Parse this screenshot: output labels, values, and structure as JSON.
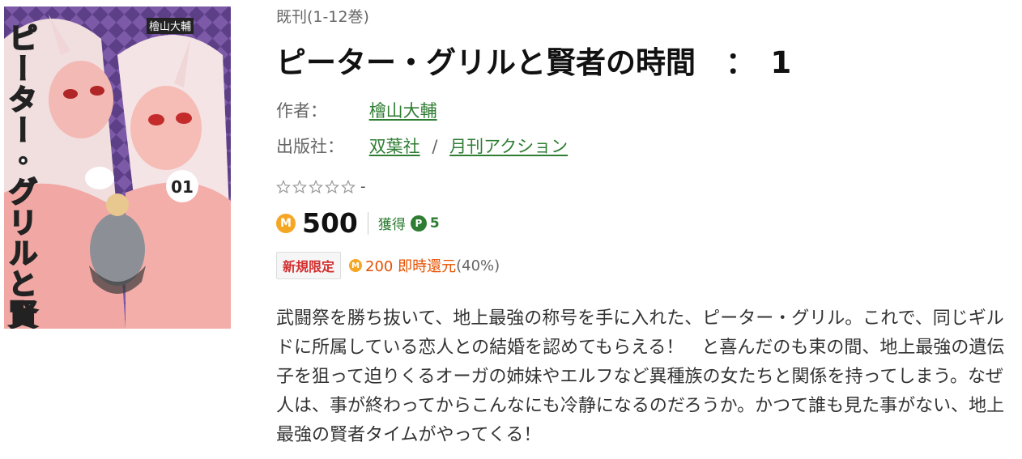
{
  "cover": {
    "title_art": "ピーター・グリルと賢者の時間",
    "author_art": "檜山大輔",
    "volume_art": "01"
  },
  "series_note": "既刊(1-12巻)",
  "book_title": "ピーター・グリルと賢者の時間　：　1",
  "author": {
    "label": "作者：",
    "name": "檜山大輔"
  },
  "publisher": {
    "label": "出版社：",
    "name": "双葉社",
    "separator": "/",
    "label_name": "月刊アクション"
  },
  "rating": {
    "dash": "-",
    "stars_filled": 0,
    "stars_total": 5
  },
  "price": {
    "coin_icon": "M",
    "value": "500",
    "earn_label": "獲得",
    "earn_icon": "P",
    "earn_value": "5"
  },
  "promo": {
    "badge": "新規限定",
    "coin_icon": "M",
    "amount": "200 即時還元",
    "rate": "(40%)"
  },
  "description": "武闘祭を勝ち抜いて、地上最強の称号を手に入れた、ピーター・グリル。これで、同じギルドに所属している恋人との結婚を認めてもらえる！　と喜んだのも束の間、地上最強の遺伝子を狙って迫りくるオーガの姉妹やエルフなど異種族の女たちと関係を持ってしまう。なぜ人は、事が終わってからこんなにも冷静になるのだろうか。かつて誰も見た事がない、地上最強の賢者タイムがやってくる！",
  "colors": {
    "link": "#2e7d32",
    "coin": "#f5a623",
    "badge_text": "#d32f2f",
    "promo_amount": "#e65100"
  }
}
